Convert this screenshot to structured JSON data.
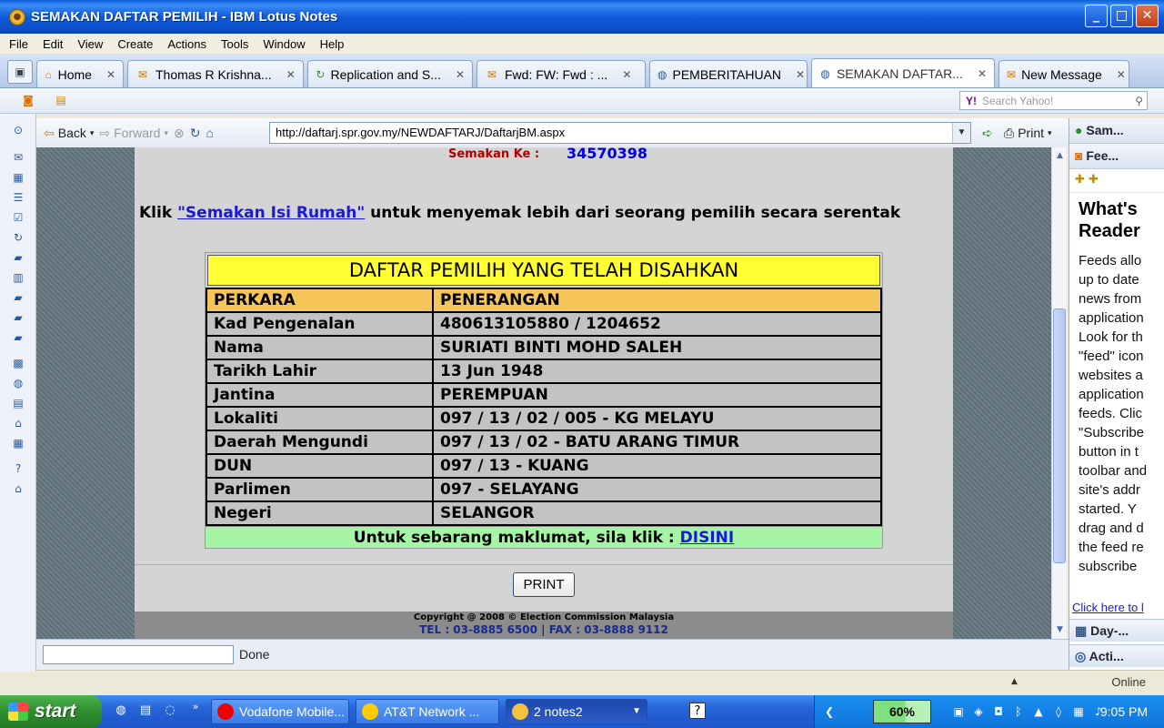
{
  "window": {
    "title": "SEMAKAN DAFTAR PEMILIH - IBM Lotus Notes"
  },
  "menu": [
    "File",
    "Edit",
    "View",
    "Create",
    "Actions",
    "Tools",
    "Window",
    "Help"
  ],
  "tabs": [
    {
      "label": "Home",
      "active": false
    },
    {
      "label": "Thomas R Krishna...",
      "active": false
    },
    {
      "label": "Replication and S...",
      "active": false
    },
    {
      "label": "Fwd: FW: Fwd : ...",
      "active": false
    },
    {
      "label": "PEMBERITAHUAN",
      "active": false
    },
    {
      "label": "SEMAKAN DAFTAR...",
      "active": true
    },
    {
      "label": "New Message",
      "active": false
    }
  ],
  "search": {
    "placeholder": "Search Yahoo!"
  },
  "nav": {
    "back": "Back",
    "forward": "Forward",
    "print": "Print",
    "url": "http://daftarj.spr.gov.my/NEWDAFTARJ/DaftarjBM.aspx"
  },
  "page": {
    "semakan_label": "Semakan Ke :",
    "semakan_value": "34570398",
    "klik_prefix": "Klik",
    "klik_link": "\"Semakan Isi Rumah\"",
    "klik_suffix": "untuk menyemak lebih dari seorang pemilih secara serentak",
    "table_title": "DAFTAR PEMILIH YANG TELAH DISAHKAN",
    "header": {
      "key": "PERKARA",
      "value": "PENERANGAN"
    },
    "rows": [
      {
        "key": "Kad Pengenalan",
        "value": "480613105880 / 1204652"
      },
      {
        "key": "Nama",
        "value": "SURIATI BINTI MOHD SALEH"
      },
      {
        "key": "Tarikh Lahir",
        "value": "13 Jun 1948"
      },
      {
        "key": "Jantina",
        "value": "PEREMPUAN"
      },
      {
        "key": "Lokaliti",
        "value": "097 / 13 / 02 / 005 - KG MELAYU"
      },
      {
        "key": "Daerah Mengundi",
        "value": "097 / 13 / 02 - BATU ARANG TIMUR"
      },
      {
        "key": "DUN",
        "value": "097 / 13 - KUANG"
      },
      {
        "key": "Parlimen",
        "value": "097 - SELAYANG"
      },
      {
        "key": "Negeri",
        "value": "SELANGOR"
      }
    ],
    "info_text": "Untuk sebarang maklumat, sila klik :",
    "info_link": "DISINI",
    "print_button": "PRINT",
    "copyright": "Copyright @ 2008 © Election Commission Malaysia",
    "contact": "TEL : 03-8885 6500 | FAX : 03-8888 9112"
  },
  "status": {
    "text": "Done",
    "online": "Online"
  },
  "sidebar": {
    "panel1": "Sam...",
    "panel2": "Fee...",
    "title_lines": [
      "What's",
      "Reader"
    ],
    "body_lines": [
      "Feeds allo",
      "up to date",
      "news from",
      "application",
      "Look for th",
      "\"feed\" icon",
      "websites a",
      "application",
      "feeds. Clic",
      "\"Subscribe",
      "button in t",
      "toolbar and",
      "site's addr",
      "started.  Y",
      "drag and d",
      "the feed re",
      "subscribe"
    ],
    "link": "Click here to l",
    "panel3": "Day-...",
    "panel4": "Acti..."
  },
  "taskbar": {
    "start": "start",
    "tasks": [
      {
        "label": "Vodafone Mobile...",
        "active": false
      },
      {
        "label": "AT&T Network ...",
        "active": false
      },
      {
        "label": "2 notes2",
        "active": true
      }
    ],
    "battery": "60%",
    "clock": "9:05 PM"
  }
}
